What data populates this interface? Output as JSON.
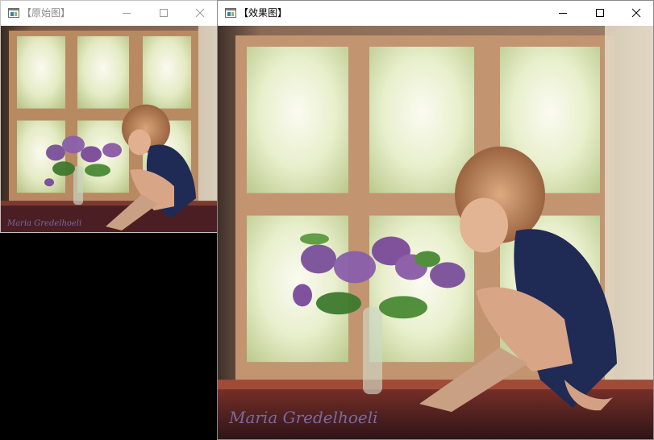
{
  "windows": {
    "original": {
      "title": "【原始图】",
      "photo_caption": "Maria Gredelhoeli"
    },
    "effect": {
      "title": "【效果图】",
      "photo_caption": "Maria Gredelhoeli"
    }
  },
  "controls": {
    "icons": [
      "minimize-icon",
      "maximize-icon",
      "close-icon"
    ]
  },
  "colors": {
    "title_inactive": "#8a8a8a",
    "title_active": "#000000",
    "background": "#000000",
    "window_frame_active": "#8a8a8a",
    "window_frame_inactive": "#c4c4c4"
  }
}
